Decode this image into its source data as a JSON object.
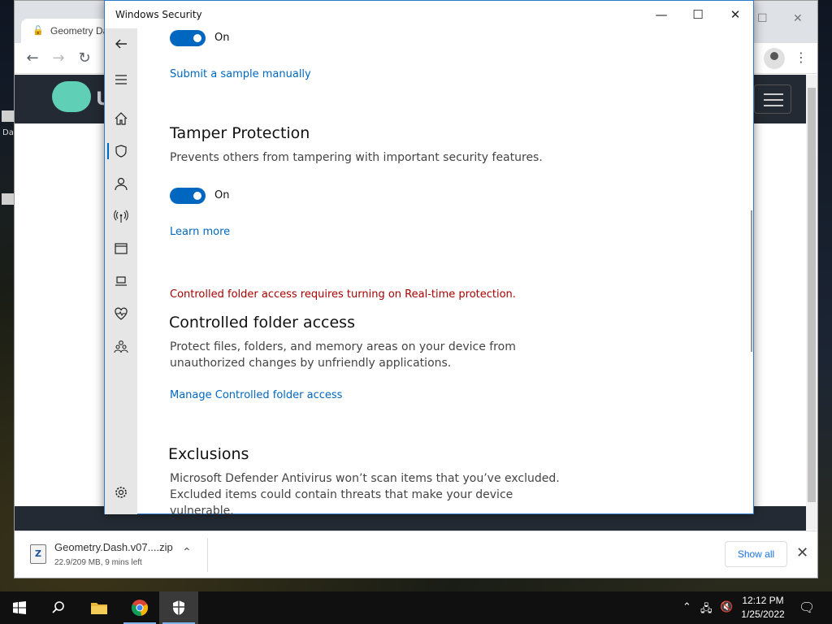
{
  "browser": {
    "tab_title": "Geometry Da",
    "site_logo_text": "U"
  },
  "desktop": {
    "label": "Da"
  },
  "download": {
    "file_name": "Geometry.Dash.v07....zip",
    "status": "22.9/209 MB, 9 mins left",
    "show_all": "Show all"
  },
  "security": {
    "window_title": "Windows Security",
    "sections": {
      "top_toggle_label": "On",
      "submit_sample_link": "Submit a sample manually",
      "tamper": {
        "heading": "Tamper Protection",
        "description": "Prevents others from tampering with important security features.",
        "toggle_label": "On",
        "learn_more": "Learn more"
      },
      "controlled": {
        "warning": "Controlled folder access requires turning on Real-time protection.",
        "heading": "Controlled folder access",
        "description": "Protect files, folders, and memory areas on your device from unauthorized changes by unfriendly applications.",
        "manage_link": "Manage Controlled folder access"
      },
      "exclusions": {
        "heading": "Exclusions",
        "description": "Microsoft Defender Antivirus won’t scan items that you’ve excluded. Excluded items could contain threats that make your device vulnerable."
      }
    },
    "sidebar_icons": [
      "back-icon",
      "menu-icon",
      "home-icon",
      "shield-icon",
      "account-icon",
      "network-icon",
      "app-browser-icon",
      "device-icon",
      "health-icon",
      "family-icon",
      "settings-icon"
    ],
    "accent_color": "#0067c0",
    "warning_color": "#a80000"
  },
  "taskbar": {
    "time": "12:12 PM",
    "date": "1/25/2022"
  }
}
